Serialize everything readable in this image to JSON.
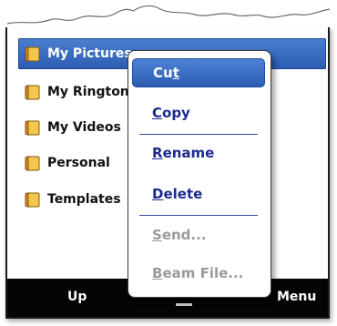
{
  "folders": [
    {
      "label": "My Pictures",
      "selected": true
    },
    {
      "label": "My Rington",
      "selected": false
    },
    {
      "label": "My Videos",
      "selected": false
    },
    {
      "label": "Personal",
      "selected": false
    },
    {
      "label": "Templates",
      "selected": false
    }
  ],
  "softkeys": {
    "left": "Up",
    "right": "Menu"
  },
  "context_menu": {
    "items": [
      {
        "accel": "",
        "rest": "Cut",
        "label": "Cut",
        "enabled": true,
        "highlighted": true
      },
      {
        "accel": "C",
        "rest": "opy",
        "label": "Copy",
        "enabled": true
      },
      {
        "accel": "R",
        "rest": "ename",
        "label": "Rename",
        "enabled": true
      },
      {
        "accel": "D",
        "rest": "elete",
        "label": "Delete",
        "enabled": true
      },
      {
        "accel": "S",
        "rest": "end...",
        "label": "Send...",
        "enabled": false
      },
      {
        "accel": "B",
        "rest": "eam File...",
        "label": "Beam File...",
        "enabled": false
      }
    ]
  },
  "colors": {
    "selection": "#2f62b8",
    "menu_text": "#1b2b8f",
    "disabled": "#9a9a9a",
    "softbar": "#050505"
  },
  "icons": {
    "folder": "folder-icon"
  }
}
